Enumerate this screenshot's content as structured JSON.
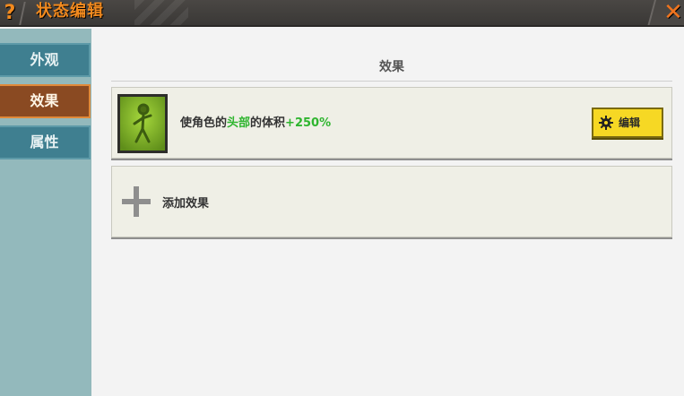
{
  "window": {
    "help_icon": "question-icon",
    "title": "状态编辑",
    "close_icon": "close-icon"
  },
  "sidebar": {
    "tabs": [
      {
        "label": "外观",
        "active": false
      },
      {
        "label": "效果",
        "active": true
      },
      {
        "label": "属性",
        "active": false
      }
    ]
  },
  "main": {
    "section_title": "效果",
    "effect": {
      "icon": "stick-figure-icon",
      "desc_prefix": "使角色的",
      "desc_highlight": "头部",
      "desc_middle": "的体积",
      "desc_value": "+250%",
      "edit_label": "编辑"
    },
    "add_effect_label": "添加效果"
  },
  "colors": {
    "accent_orange": "#f28a1e",
    "highlight_green": "#2fb52f",
    "edit_button_yellow": "#f6d824",
    "sidebar_tab": "#3f7f90",
    "sidebar_active_tab": "#8a4a22"
  }
}
